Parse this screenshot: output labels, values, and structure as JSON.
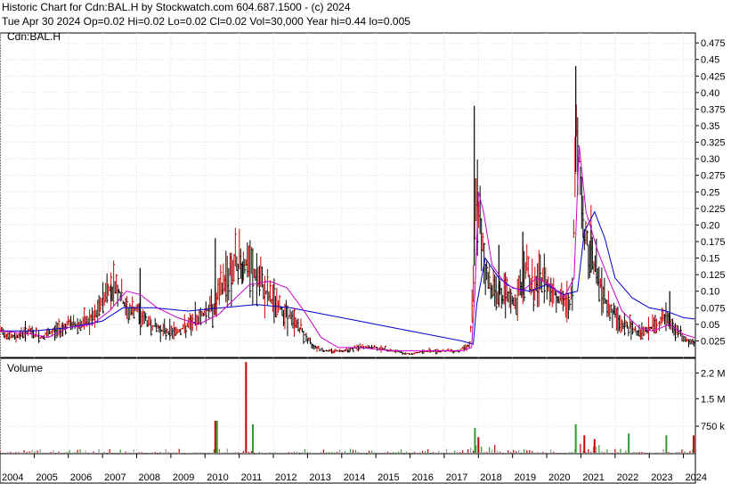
{
  "header": {
    "line1": "Historic Chart for Cdn:BAL.H by Stockwatch.com 604.687.1500 - (c) 2024",
    "line2": "Tue Apr 30 2024  Op=0.02  Hi=0.02  Lo=0.02  Cl=0.02  Vol=30,000  Year hi=0.44  lo=0.005"
  },
  "chart_data": {
    "type": "line",
    "title": "Historic Chart for Cdn:BAL.H by Stockwatch.com 604.687.1500 - (c) 2024",
    "price_panel_label": "Cdn:BAL.H",
    "volume_panel_label": "Volume",
    "price_ylim": [
      0,
      0.49
    ],
    "price_ticks": [
      "0.025",
      "0.05",
      "0.075",
      "0.10",
      "0.125",
      "0.15",
      "0.175",
      "0.20",
      "0.225",
      "0.25",
      "0.275",
      "0.30",
      "0.325",
      "0.35",
      "0.375",
      "0.40",
      "0.425",
      "0.45",
      "0.475"
    ],
    "volume_ylim": [
      0,
      2600000
    ],
    "volume_ticks": [
      {
        "label": "750 k",
        "value": 750000
      },
      {
        "label": "1.5 M",
        "value": 1500000
      },
      {
        "label": "2.2 M",
        "value": 2200000
      }
    ],
    "years": [
      "2004",
      "2005",
      "2006",
      "2007",
      "2008",
      "2009",
      "2010",
      "2011",
      "2012",
      "2013",
      "2014",
      "2015",
      "2016",
      "2017",
      "2018",
      "2019",
      "2020",
      "2021",
      "2022",
      "2023",
      "2024"
    ],
    "xlim": [
      2004.0,
      2024.35
    ],
    "colors": {
      "up": "#cc0000",
      "down": "#000000",
      "ma_long": "#0000cc",
      "ma_short": "#cc00cc",
      "vol_up": "#cc0000",
      "vol_down": "#339933",
      "vol_neutral": "#999999"
    },
    "price_series": [
      {
        "x": 2004.0,
        "y": 0.04
      },
      {
        "x": 2004.4,
        "y": 0.03
      },
      {
        "x": 2004.8,
        "y": 0.04
      },
      {
        "x": 2005.2,
        "y": 0.03
      },
      {
        "x": 2005.6,
        "y": 0.04
      },
      {
        "x": 2006.0,
        "y": 0.05
      },
      {
        "x": 2006.4,
        "y": 0.05
      },
      {
        "x": 2006.8,
        "y": 0.06
      },
      {
        "x": 2007.1,
        "y": 0.1
      },
      {
        "x": 2007.4,
        "y": 0.11
      },
      {
        "x": 2007.7,
        "y": 0.07
      },
      {
        "x": 2008.0,
        "y": 0.07
      },
      {
        "x": 2008.4,
        "y": 0.05
      },
      {
        "x": 2008.8,
        "y": 0.04
      },
      {
        "x": 2009.2,
        "y": 0.04
      },
      {
        "x": 2009.6,
        "y": 0.05
      },
      {
        "x": 2010.0,
        "y": 0.07
      },
      {
        "x": 2010.3,
        "y": 0.08
      },
      {
        "x": 2010.6,
        "y": 0.12
      },
      {
        "x": 2010.9,
        "y": 0.14
      },
      {
        "x": 2011.2,
        "y": 0.14
      },
      {
        "x": 2011.5,
        "y": 0.12
      },
      {
        "x": 2011.9,
        "y": 0.09
      },
      {
        "x": 2012.3,
        "y": 0.07
      },
      {
        "x": 2012.7,
        "y": 0.05
      },
      {
        "x": 2013.1,
        "y": 0.02
      },
      {
        "x": 2013.5,
        "y": 0.01
      },
      {
        "x": 2014.0,
        "y": 0.01
      },
      {
        "x": 2014.5,
        "y": 0.015
      },
      {
        "x": 2015.0,
        "y": 0.015
      },
      {
        "x": 2015.5,
        "y": 0.01
      },
      {
        "x": 2016.0,
        "y": 0.005
      },
      {
        "x": 2016.5,
        "y": 0.01
      },
      {
        "x": 2017.0,
        "y": 0.01
      },
      {
        "x": 2017.4,
        "y": 0.01
      },
      {
        "x": 2017.75,
        "y": 0.02
      },
      {
        "x": 2017.85,
        "y": 0.1
      },
      {
        "x": 2017.92,
        "y": 0.27
      },
      {
        "x": 2018.0,
        "y": 0.2
      },
      {
        "x": 2018.1,
        "y": 0.18
      },
      {
        "x": 2018.25,
        "y": 0.12
      },
      {
        "x": 2018.5,
        "y": 0.1
      },
      {
        "x": 2018.8,
        "y": 0.09
      },
      {
        "x": 2019.1,
        "y": 0.08
      },
      {
        "x": 2019.4,
        "y": 0.14
      },
      {
        "x": 2019.6,
        "y": 0.1
      },
      {
        "x": 2019.9,
        "y": 0.12
      },
      {
        "x": 2020.2,
        "y": 0.1
      },
      {
        "x": 2020.5,
        "y": 0.08
      },
      {
        "x": 2020.75,
        "y": 0.09
      },
      {
        "x": 2020.85,
        "y": 0.35
      },
      {
        "x": 2020.95,
        "y": 0.3
      },
      {
        "x": 2021.1,
        "y": 0.18
      },
      {
        "x": 2021.3,
        "y": 0.16
      },
      {
        "x": 2021.6,
        "y": 0.1
      },
      {
        "x": 2021.9,
        "y": 0.07
      },
      {
        "x": 2022.2,
        "y": 0.05
      },
      {
        "x": 2022.6,
        "y": 0.04
      },
      {
        "x": 2022.9,
        "y": 0.04
      },
      {
        "x": 2023.2,
        "y": 0.05
      },
      {
        "x": 2023.5,
        "y": 0.06
      },
      {
        "x": 2023.8,
        "y": 0.04
      },
      {
        "x": 2024.1,
        "y": 0.025
      },
      {
        "x": 2024.33,
        "y": 0.02
      }
    ],
    "ma_short": [
      {
        "x": 2004.0,
        "y": 0.04
      },
      {
        "x": 2005.0,
        "y": 0.035
      },
      {
        "x": 2005.4,
        "y": 0.03
      },
      {
        "x": 2006.0,
        "y": 0.045
      },
      {
        "x": 2006.7,
        "y": 0.05
      },
      {
        "x": 2007.2,
        "y": 0.07
      },
      {
        "x": 2007.7,
        "y": 0.1
      },
      {
        "x": 2008.1,
        "y": 0.095
      },
      {
        "x": 2008.6,
        "y": 0.075
      },
      {
        "x": 2009.2,
        "y": 0.06
      },
      {
        "x": 2009.8,
        "y": 0.05
      },
      {
        "x": 2010.4,
        "y": 0.065
      },
      {
        "x": 2010.9,
        "y": 0.09
      },
      {
        "x": 2011.3,
        "y": 0.11
      },
      {
        "x": 2011.9,
        "y": 0.115
      },
      {
        "x": 2012.4,
        "y": 0.105
      },
      {
        "x": 2012.9,
        "y": 0.07
      },
      {
        "x": 2013.4,
        "y": 0.03
      },
      {
        "x": 2013.9,
        "y": 0.015
      },
      {
        "x": 2014.5,
        "y": 0.015
      },
      {
        "x": 2015.5,
        "y": 0.01
      },
      {
        "x": 2016.5,
        "y": 0.01
      },
      {
        "x": 2017.5,
        "y": 0.01
      },
      {
        "x": 2017.8,
        "y": 0.015
      },
      {
        "x": 2017.9,
        "y": 0.1
      },
      {
        "x": 2018.0,
        "y": 0.25
      },
      {
        "x": 2018.15,
        "y": 0.22
      },
      {
        "x": 2018.4,
        "y": 0.14
      },
      {
        "x": 2018.8,
        "y": 0.11
      },
      {
        "x": 2019.3,
        "y": 0.1
      },
      {
        "x": 2019.7,
        "y": 0.12
      },
      {
        "x": 2020.1,
        "y": 0.11
      },
      {
        "x": 2020.5,
        "y": 0.09
      },
      {
        "x": 2020.8,
        "y": 0.12
      },
      {
        "x": 2020.95,
        "y": 0.32
      },
      {
        "x": 2021.15,
        "y": 0.22
      },
      {
        "x": 2021.5,
        "y": 0.16
      },
      {
        "x": 2021.8,
        "y": 0.12
      },
      {
        "x": 2022.2,
        "y": 0.07
      },
      {
        "x": 2022.7,
        "y": 0.045
      },
      {
        "x": 2023.1,
        "y": 0.04
      },
      {
        "x": 2023.6,
        "y": 0.05
      },
      {
        "x": 2024.0,
        "y": 0.035
      },
      {
        "x": 2024.33,
        "y": 0.03
      }
    ],
    "ma_long": [
      {
        "x": 2004.0,
        "y": 0.04
      },
      {
        "x": 2005.0,
        "y": 0.04
      },
      {
        "x": 2006.0,
        "y": 0.045
      },
      {
        "x": 2007.0,
        "y": 0.055
      },
      {
        "x": 2007.6,
        "y": 0.075
      },
      {
        "x": 2008.5,
        "y": 0.075
      },
      {
        "x": 2009.5,
        "y": 0.07
      },
      {
        "x": 2010.5,
        "y": 0.075
      },
      {
        "x": 2011.5,
        "y": 0.08
      },
      {
        "x": 2012.5,
        "y": 0.075
      },
      {
        "x": 2013.5,
        "y": 0.065
      },
      {
        "x": 2014.5,
        "y": 0.055
      },
      {
        "x": 2015.5,
        "y": 0.045
      },
      {
        "x": 2016.5,
        "y": 0.035
      },
      {
        "x": 2017.5,
        "y": 0.025
      },
      {
        "x": 2017.85,
        "y": 0.02
      },
      {
        "x": 2017.95,
        "y": 0.08
      },
      {
        "x": 2018.2,
        "y": 0.15
      },
      {
        "x": 2018.6,
        "y": 0.12
      },
      {
        "x": 2019.0,
        "y": 0.105
      },
      {
        "x": 2019.5,
        "y": 0.1
      },
      {
        "x": 2020.0,
        "y": 0.11
      },
      {
        "x": 2020.5,
        "y": 0.095
      },
      {
        "x": 2020.9,
        "y": 0.1
      },
      {
        "x": 2021.1,
        "y": 0.19
      },
      {
        "x": 2021.4,
        "y": 0.22
      },
      {
        "x": 2021.7,
        "y": 0.18
      },
      {
        "x": 2022.0,
        "y": 0.12
      },
      {
        "x": 2022.5,
        "y": 0.09
      },
      {
        "x": 2023.0,
        "y": 0.075
      },
      {
        "x": 2023.5,
        "y": 0.07
      },
      {
        "x": 2024.0,
        "y": 0.06
      },
      {
        "x": 2024.33,
        "y": 0.058
      }
    ],
    "spikes": [
      {
        "x": 2007.25,
        "y": 0.11
      },
      {
        "x": 2008.1,
        "y": 0.135
      },
      {
        "x": 2010.3,
        "y": 0.18
      },
      {
        "x": 2011.1,
        "y": 0.145
      },
      {
        "x": 2017.88,
        "y": 0.38
      },
      {
        "x": 2018.6,
        "y": 0.17
      },
      {
        "x": 2019.3,
        "y": 0.19
      },
      {
        "x": 2020.85,
        "y": 0.44
      },
      {
        "x": 2021.3,
        "y": 0.2
      },
      {
        "x": 2023.6,
        "y": 0.1
      }
    ],
    "volume_spikes": [
      {
        "x": 2010.3,
        "v": 900000,
        "dir": "up"
      },
      {
        "x": 2010.35,
        "v": 900000,
        "dir": "down"
      },
      {
        "x": 2011.2,
        "v": 2500000,
        "dir": "up"
      },
      {
        "x": 2011.4,
        "v": 800000,
        "dir": "down"
      },
      {
        "x": 2017.9,
        "v": 700000,
        "dir": "down"
      },
      {
        "x": 2018.0,
        "v": 450000,
        "dir": "up"
      },
      {
        "x": 2020.85,
        "v": 800000,
        "dir": "down"
      },
      {
        "x": 2021.1,
        "v": 500000,
        "dir": "up"
      },
      {
        "x": 2021.4,
        "v": 400000,
        "dir": "up"
      },
      {
        "x": 2022.4,
        "v": 550000,
        "dir": "down"
      },
      {
        "x": 2023.5,
        "v": 500000,
        "dir": "down"
      },
      {
        "x": 2024.3,
        "v": 500000,
        "dir": "up"
      }
    ]
  }
}
